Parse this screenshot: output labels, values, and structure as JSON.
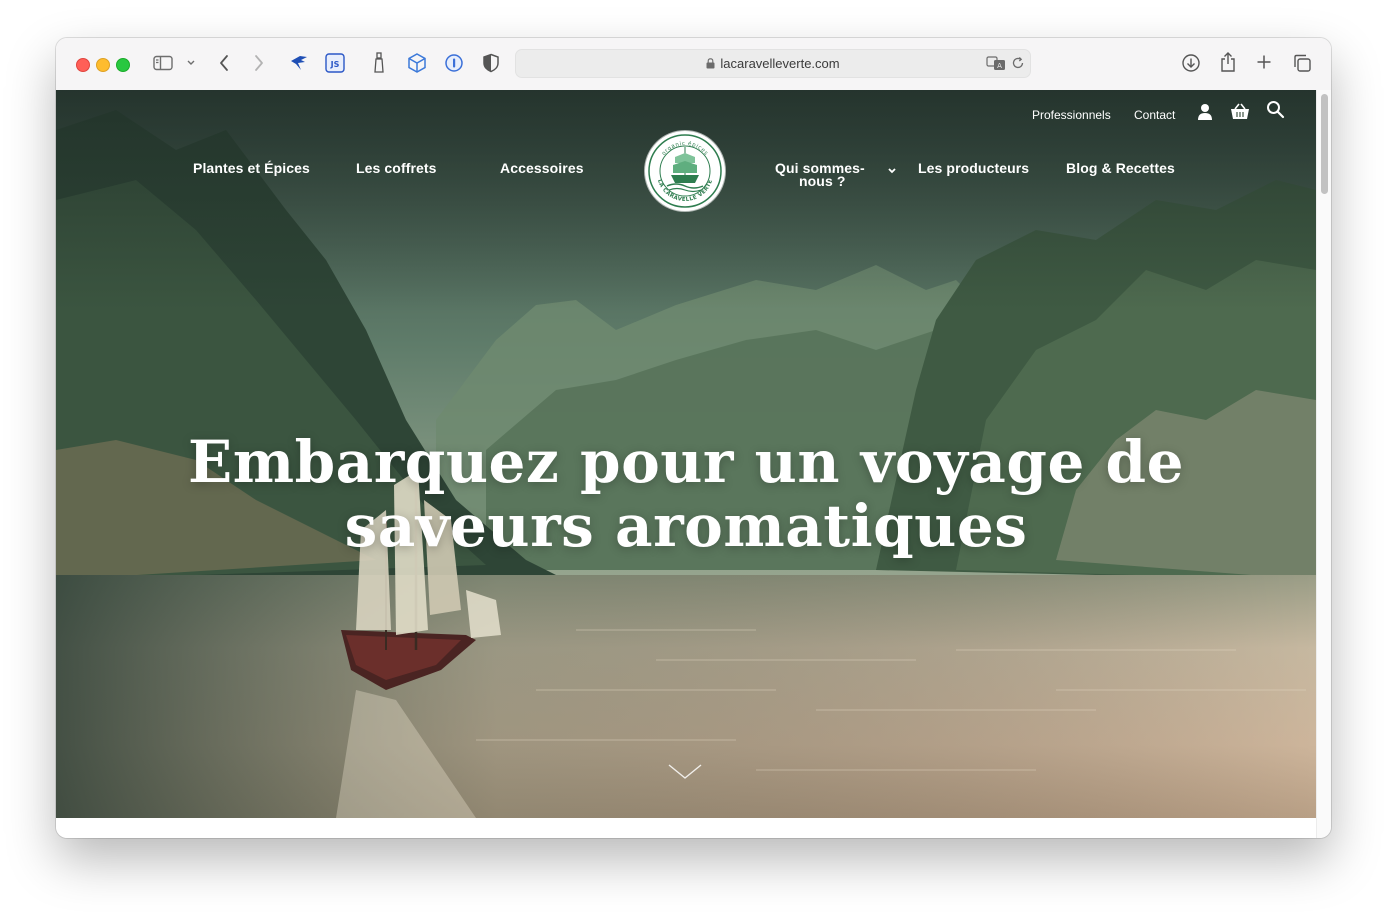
{
  "browser": {
    "url": "lacaravelleverte.com",
    "icons": [
      "sidebar-icon",
      "chevron-down-icon",
      "back-icon",
      "forward-icon",
      "extension-bird-icon",
      "extension-js-icon",
      "extension-bottle-icon",
      "extension-cube-icon",
      "extension-1password-icon",
      "extension-shield-icon",
      "lock-icon",
      "translate-icon",
      "reload-icon",
      "download-icon",
      "share-icon",
      "new-tab-icon",
      "tabs-overview-icon"
    ]
  },
  "site": {
    "top_links": {
      "professionnels": "Professionnels",
      "contact": "Contact"
    },
    "top_icons": [
      "user-icon",
      "basket-icon",
      "search-icon"
    ],
    "nav": {
      "plantes": "Plantes et Épices",
      "coffrets": "Les coffrets",
      "accessoires": "Accessoires",
      "qui_line1": "Qui sommes-",
      "qui_line2": "nous ?",
      "producteurs": "Les producteurs",
      "blog": "Blog & Recettes"
    },
    "logo": {
      "top_text": "organic épices",
      "bottom_text": "LA CARAVELLE VERTE"
    },
    "hero": {
      "headline_line1": "Embarquez pour un voyage de",
      "headline_line2": "saveurs aromatiques"
    },
    "colors": {
      "brand_green": "#2e7d4f",
      "hero_sky": "#5f7a62",
      "hero_water": "#c4b29a"
    }
  }
}
